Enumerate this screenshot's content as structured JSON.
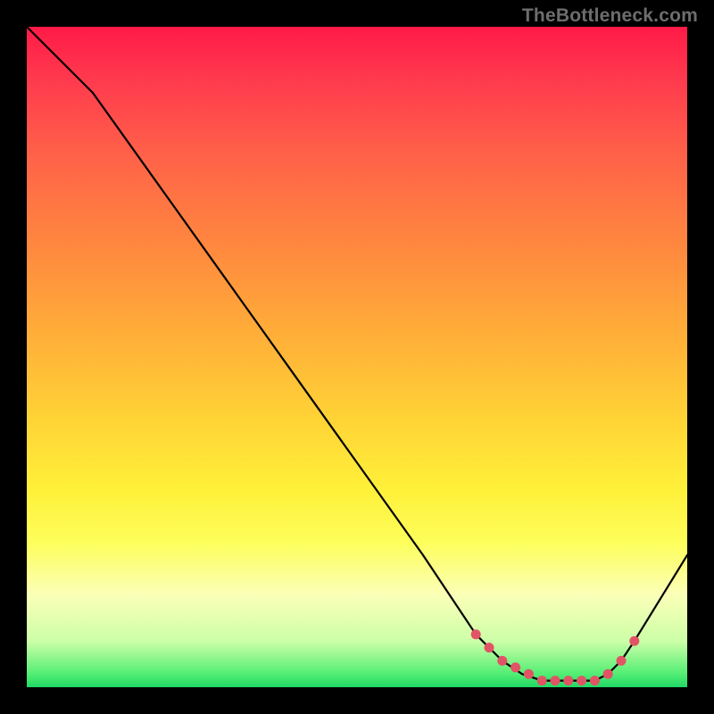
{
  "watermark": "TheBottleneck.com",
  "chart_data": {
    "type": "line",
    "title": "",
    "xlabel": "",
    "ylabel": "",
    "xlim": [
      0,
      100
    ],
    "ylim": [
      0,
      100
    ],
    "gradient_stops": [
      {
        "pct": 0,
        "color": "#ff1a47"
      },
      {
        "pct": 8,
        "color": "#ff3a4e"
      },
      {
        "pct": 20,
        "color": "#ff6348"
      },
      {
        "pct": 34,
        "color": "#ff8a3e"
      },
      {
        "pct": 48,
        "color": "#ffb238"
      },
      {
        "pct": 60,
        "color": "#ffd536"
      },
      {
        "pct": 70,
        "color": "#fff039"
      },
      {
        "pct": 78,
        "color": "#fdfe5a"
      },
      {
        "pct": 86,
        "color": "#fbffb7"
      },
      {
        "pct": 93,
        "color": "#cdffa8"
      },
      {
        "pct": 98,
        "color": "#52ee74"
      },
      {
        "pct": 100,
        "color": "#20d865"
      }
    ],
    "series": [
      {
        "name": "bottleneck-curve",
        "x": [
          0,
          6,
          10,
          20,
          30,
          40,
          50,
          60,
          68,
          72,
          75,
          78,
          80,
          82,
          84,
          86,
          88,
          90,
          92,
          100
        ],
        "y": [
          100,
          94,
          90,
          76,
          62,
          48,
          34,
          20,
          8,
          4,
          2,
          1,
          1,
          1,
          1,
          1,
          2,
          4,
          7,
          20
        ]
      }
    ],
    "markers": {
      "name": "optimal-range-dots",
      "x": [
        68,
        70,
        72,
        74,
        76,
        78,
        80,
        82,
        84,
        86,
        88,
        90,
        92
      ],
      "y": [
        8,
        6,
        4,
        3,
        2,
        1,
        1,
        1,
        1,
        1,
        2,
        4,
        7
      ]
    }
  }
}
